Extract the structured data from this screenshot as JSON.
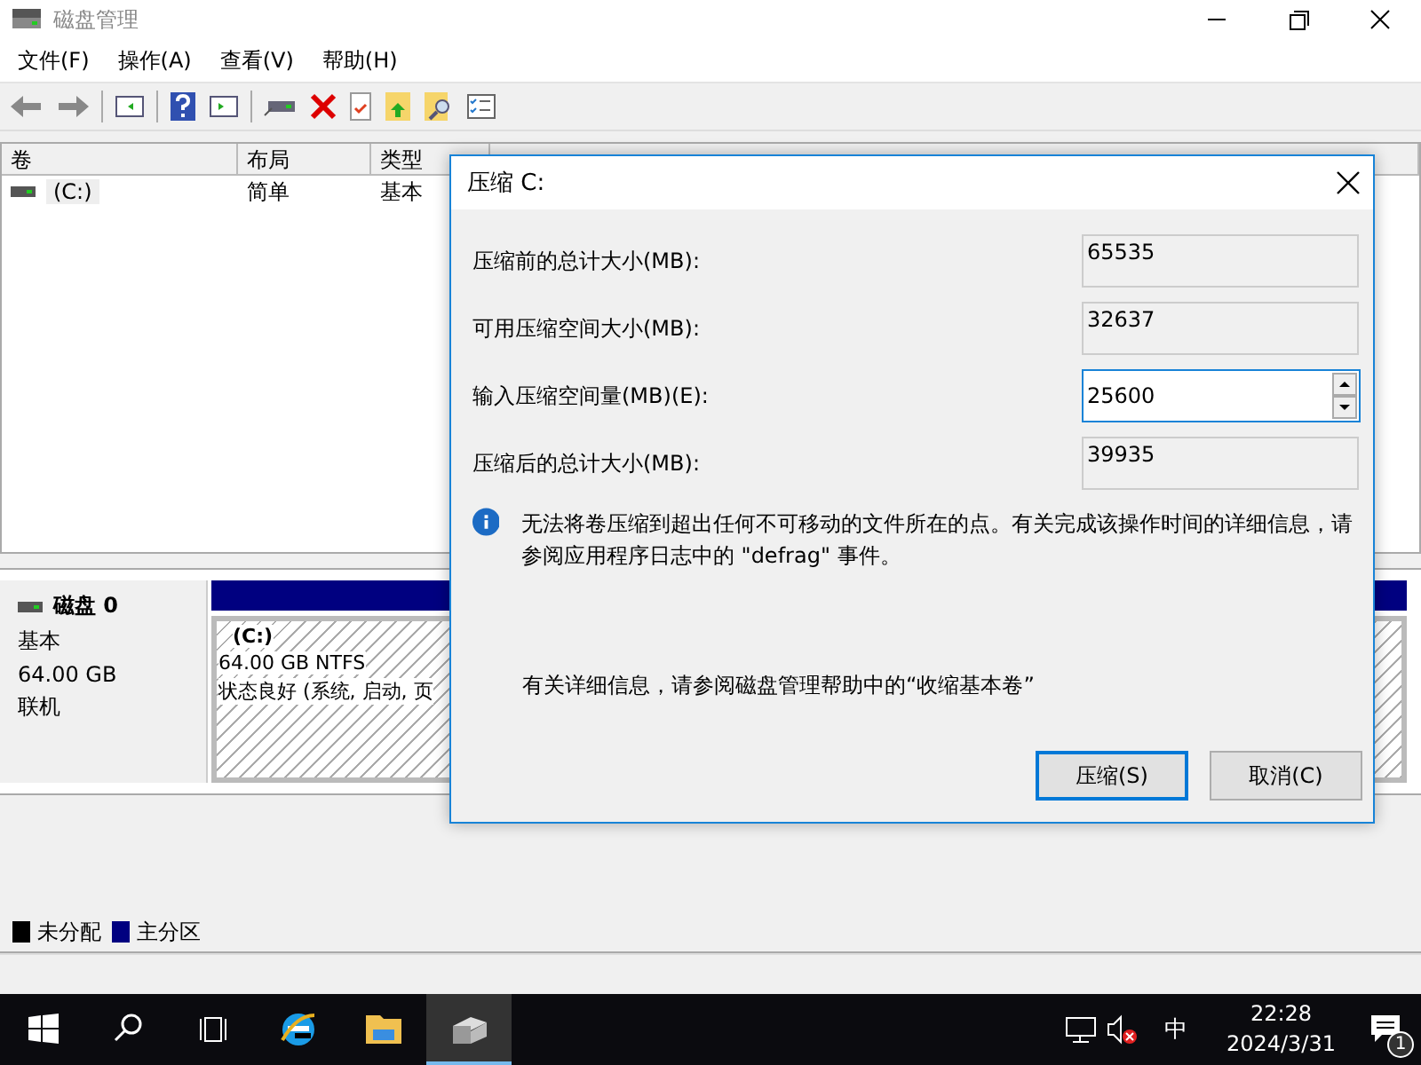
{
  "window": {
    "title": "磁盘管理"
  },
  "menu": [
    "文件(F)",
    "操作(A)",
    "查看(V)",
    "帮助(H)"
  ],
  "volume_table": {
    "columns": [
      "卷",
      "布局",
      "类型"
    ],
    "rows": [
      {
        "cells": [
          "(C:)",
          "简单",
          "基本"
        ]
      }
    ]
  },
  "disk": {
    "name": "磁盘 0",
    "type": "基本",
    "size": "64.00 GB",
    "status": "联机",
    "partition": {
      "name": "(C:)",
      "size": "64.00 GB NTFS",
      "status": "状态良好 (系统, 启动, 页"
    }
  },
  "legend": [
    {
      "label": "未分配",
      "color": "#000000"
    },
    {
      "label": "主分区",
      "color": "#000080"
    }
  ],
  "dialog": {
    "title": "压缩 C:",
    "fields": [
      {
        "label": "压缩前的总计大小(MB):",
        "value": "65535",
        "kind": "readonly"
      },
      {
        "label": "可用压缩空间大小(MB):",
        "value": "32637",
        "kind": "readonly"
      },
      {
        "label": "输入压缩空间量(MB)(E):",
        "value": "25600",
        "kind": "spin"
      },
      {
        "label": "压缩后的总计大小(MB):",
        "value": "39935",
        "kind": "readonly"
      }
    ],
    "info": "无法将卷压缩到超出任何不可移动的文件所在的点。有关完成该操作时间的详细信息，请参阅应用程序日志中的 \"defrag\" 事件。",
    "help": "有关详细信息，请参阅磁盘管理帮助中的“收缩基本卷”",
    "buttons": [
      {
        "label": "压缩(S)",
        "default": true
      },
      {
        "label": "取消(C)",
        "default": false
      }
    ]
  },
  "taskbar": {
    "ime": "中",
    "time": "22:28",
    "date": "2024/3/31",
    "notifications": "1"
  }
}
